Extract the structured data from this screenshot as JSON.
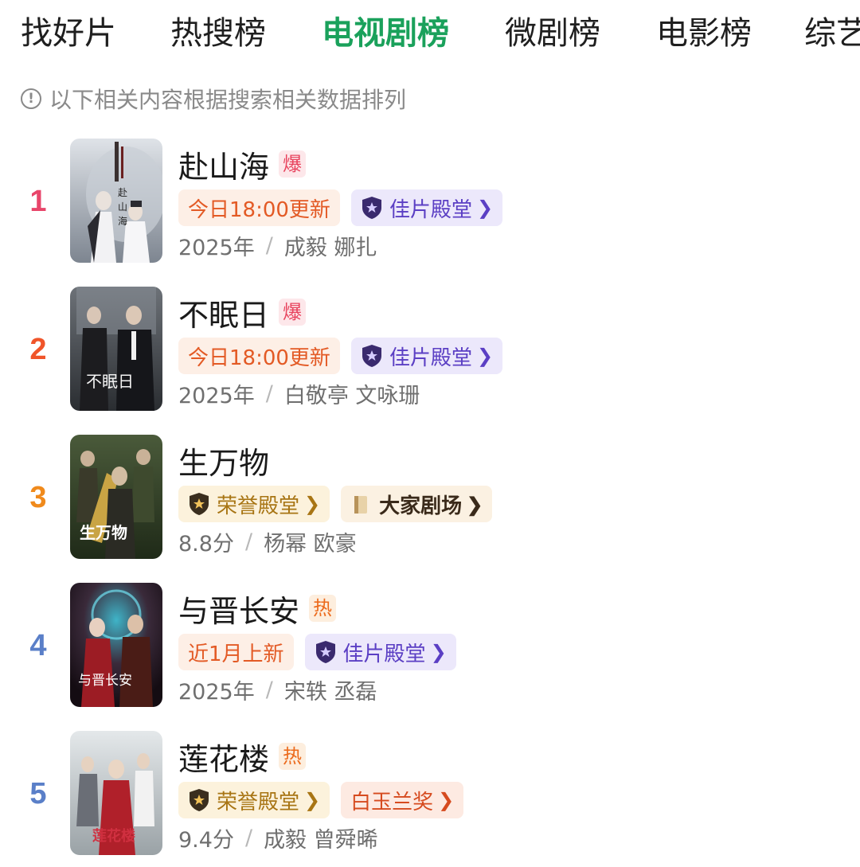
{
  "tabs": [
    {
      "label": "找好片",
      "active": false
    },
    {
      "label": "热搜榜",
      "active": false
    },
    {
      "label": "电视剧榜",
      "active": true
    },
    {
      "label": "微剧榜",
      "active": false
    },
    {
      "label": "电影榜",
      "active": false
    },
    {
      "label": "综艺",
      "active": false
    }
  ],
  "notice": {
    "icon": "info-circle-icon",
    "text": "以下相关内容根据搜索相关数据排列"
  },
  "colors": {
    "accent": "#1aa15b",
    "rank_1": "#e8456a",
    "rank_2": "#f0552a",
    "rank_3": "#f08a1c",
    "rank_4": "#5a7fc8",
    "rank_5": "#5a7fc8"
  },
  "items": [
    {
      "rank": "1",
      "title": "赴山海",
      "badge": "爆",
      "badge_type": "bao",
      "tags": [
        {
          "type": "update",
          "label": "今日18:00更新"
        },
        {
          "type": "purple",
          "label": "佳片殿堂",
          "icon": "purple-shield-icon"
        }
      ],
      "meta_left": "2025年",
      "meta_sep": "/",
      "meta_right": "成毅  娜扎"
    },
    {
      "rank": "2",
      "title": "不眠日",
      "badge": "爆",
      "badge_type": "bao",
      "poster_text": "不眠日",
      "tags": [
        {
          "type": "update",
          "label": "今日18:00更新"
        },
        {
          "type": "purple",
          "label": "佳片殿堂",
          "icon": "purple-shield-icon"
        }
      ],
      "meta_left": "2025年",
      "meta_sep": "/",
      "meta_right": "白敬亭  文咏珊"
    },
    {
      "rank": "3",
      "title": "生万物",
      "badge": "",
      "badge_type": "",
      "poster_text": "生万物",
      "tags": [
        {
          "type": "gold",
          "label": "荣誉殿堂",
          "icon": "gold-shield-icon"
        },
        {
          "type": "dajia",
          "label": "大家剧场",
          "icon": "scroll-icon"
        }
      ],
      "meta_left": "8.8分",
      "meta_sep": "/",
      "meta_right": "杨幂  欧豪"
    },
    {
      "rank": "4",
      "title": "与晋长安",
      "badge": "热",
      "badge_type": "re",
      "poster_text": "与晋长安",
      "tags": [
        {
          "type": "update",
          "label": "近1月上新"
        },
        {
          "type": "purple",
          "label": "佳片殿堂",
          "icon": "purple-shield-icon"
        }
      ],
      "meta_left": "2025年",
      "meta_sep": "/",
      "meta_right": "宋轶  丞磊"
    },
    {
      "rank": "5",
      "title": "莲花楼",
      "badge": "热",
      "badge_type": "re",
      "poster_text": "莲花楼",
      "tags": [
        {
          "type": "gold",
          "label": "荣誉殿堂",
          "icon": "gold-shield-icon"
        },
        {
          "type": "award",
          "label": "白玉兰奖"
        }
      ],
      "meta_left": "9.4分",
      "meta_sep": "/",
      "meta_right": "成毅  曾舜晞"
    }
  ]
}
